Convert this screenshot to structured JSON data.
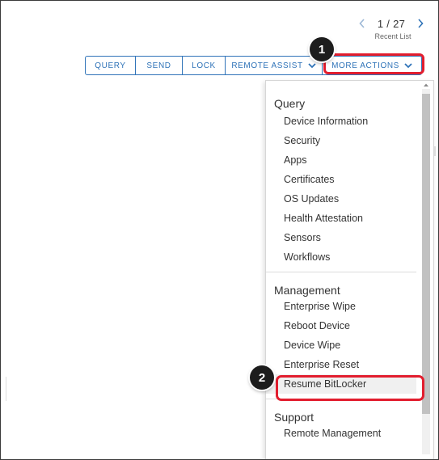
{
  "pager": {
    "count": "1 / 27",
    "recent_label": "Recent List"
  },
  "toolbar": {
    "query": "QUERY",
    "send": "SEND",
    "lock": "LOCK",
    "remote_assist": "REMOTE ASSIST",
    "more_actions": "MORE ACTIONS"
  },
  "badges": {
    "step1": "1",
    "step2": "2"
  },
  "menu": {
    "query": {
      "header": "Query",
      "items": [
        "Device Information",
        "Security",
        "Apps",
        "Certificates",
        "OS Updates",
        "Health Attestation",
        "Sensors",
        "Workflows"
      ]
    },
    "management": {
      "header": "Management",
      "items": [
        "Enterprise Wipe",
        "Reboot Device",
        "Device Wipe",
        "Enterprise Reset",
        "Resume BitLocker"
      ]
    },
    "support": {
      "header": "Support",
      "items": [
        "Remote Management"
      ]
    }
  },
  "colors": {
    "accent": "#2f73b8",
    "highlight": "#e21d2e",
    "badge": "#1d1d1d"
  },
  "icons": {
    "prev": "chevron-left-icon",
    "next": "chevron-right-icon",
    "dropdown": "chevron-down-icon"
  }
}
